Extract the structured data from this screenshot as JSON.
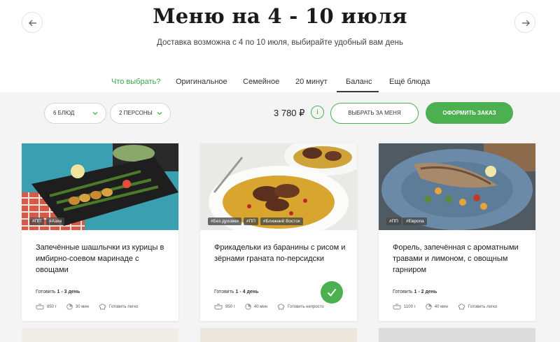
{
  "header": {
    "title": "Меню на 4 - 10 июля",
    "subtitle": "Доставка возможна с 4 по 10 июля, выбирайте удобный вам день",
    "prev_icon": "arrow-left-icon",
    "next_icon": "arrow-right-icon"
  },
  "tabs": [
    {
      "label": "Что выбрать?"
    },
    {
      "label": "Оригинальное"
    },
    {
      "label": "Семейное"
    },
    {
      "label": "20 минут"
    },
    {
      "label": "Баланс"
    },
    {
      "label": "Ещё блюда"
    }
  ],
  "active_tab": "Баланс",
  "toolbar": {
    "dishes_select": "6 БЛЮД",
    "persons_select": "2 ПЕРСОНЫ",
    "price": "3 780 ₽",
    "info_label": "i",
    "choose_for_me": "ВЫБРАТЬ ЗА МЕНЯ",
    "checkout": "ОФОРМИТЬ ЗАКАЗ"
  },
  "colors": {
    "accent": "#4cb051",
    "background_band": "#f4f4f4"
  },
  "cards": [
    {
      "tags": [
        "#ПП",
        "#Азия"
      ],
      "title": "Запечённые шашлычки из курицы в имбирно-соевом маринаде с овощами",
      "cook_prefix": "Готовить ",
      "cook_days": "1 - 3 день",
      "weight": "850 г",
      "time": "30 мин",
      "difficulty": "Готовить легко"
    },
    {
      "tags": [
        "#Без духовки",
        "#ПП",
        "#Ближний Восток"
      ],
      "title": "Фрикадельки из баранины с рисом и зёрнами граната по-персидски",
      "cook_prefix": "Готовить ",
      "cook_days": "1 - 4 день",
      "weight": "950 г",
      "time": "40 мин",
      "difficulty": "Готовить непросто",
      "selected": true
    },
    {
      "tags": [
        "#ПП",
        "#Европа"
      ],
      "title": "Форель, запечённая с ароматными травами и лимоном, с овощным гарниром",
      "cook_prefix": "Готовить ",
      "cook_days": "1 - 2 день",
      "weight": "1100 г",
      "time": "40 мин",
      "difficulty": "Готовить легко"
    }
  ]
}
